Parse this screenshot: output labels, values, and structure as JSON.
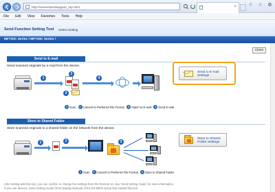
{
  "browser": {
    "url": "http://••••••••/sendsupport_top.html",
    "menu": [
      "File",
      "Edit",
      "View",
      "Favorites",
      "Tools",
      "Help"
    ]
  },
  "app": {
    "title": "Send Function Setting Tool",
    "subtitle": "Select Setting",
    "model": "MF720C Series / MF720C Series /",
    "close_label": "Close"
  },
  "email_section": {
    "heading": "Send to E-mail",
    "description": "Send scanned originals by e-mail from the device.",
    "steps": [
      "Scan",
      "Convert to Preferred File Format",
      "Attach to E-mail",
      "Send E-mail"
    ],
    "button_label": "Send to E-mail Settings"
  },
  "folder_section": {
    "heading": "Store to Shared Folder",
    "description": "Store scanned originals to a shared folder on the network from the device.",
    "steps": [
      "Scan",
      "Convert to Preferred File Format",
      "Store to Shared Folder"
    ],
    "button_label": "Store to Shared Folder Settings"
  },
  "footer": {
    "line1": "After setting with this tool, you can confirm or change the settings from the Remote UI. See 'Send Setting Guide' for more information.",
    "line2": "If you use devices, Send Setting Guide (from Display Manual) of the E5-90RX Setup that started this tool."
  },
  "colors": {
    "accent": "#1b5fb0",
    "highlight": "#f2a413",
    "model_bar": "#1b4f9c"
  }
}
